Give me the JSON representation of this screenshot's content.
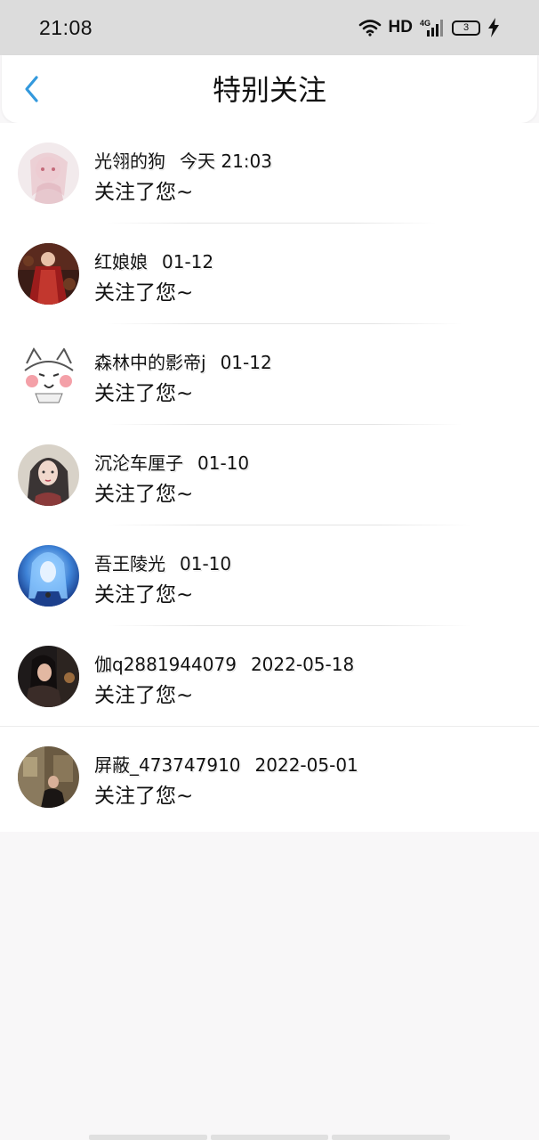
{
  "status_bar": {
    "time": "21:08",
    "hd_label": "HD",
    "network_label": "4G",
    "battery_level": "3"
  },
  "header": {
    "title": "特别关注",
    "accent_color": "#3399dd"
  },
  "items": [
    {
      "name": "光翎的狗",
      "time": "今天 21:03",
      "message": "关注了您~",
      "avatar_icon": "avatar-pink-anime"
    },
    {
      "name": "红娘娘",
      "time": "01-12",
      "message": "关注了您~",
      "avatar_icon": "avatar-red-dress"
    },
    {
      "name": "森林中的影帝j",
      "time": "01-12",
      "message": "关注了您~",
      "avatar_icon": "avatar-cartoon-cat"
    },
    {
      "name": "沉沦车厘子",
      "time": "01-10",
      "message": "关注了您~",
      "avatar_icon": "avatar-dark-hair-girl"
    },
    {
      "name": "吾王陵光",
      "time": "01-10",
      "message": "关注了您~",
      "avatar_icon": "avatar-blue-hero"
    },
    {
      "name": "伽q2881944079",
      "time": "2022-05-18",
      "message": "关注了您~",
      "avatar_icon": "avatar-night-photo"
    },
    {
      "name": "屏蔽_473747910",
      "time": "2022-05-01",
      "message": "关注了您~",
      "avatar_icon": "avatar-room-photo"
    }
  ]
}
